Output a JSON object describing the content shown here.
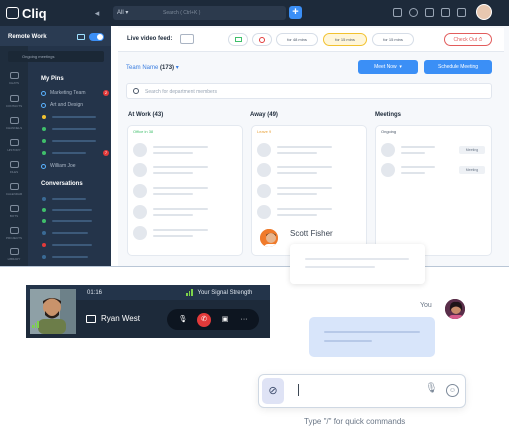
{
  "app": {
    "logo_text": "Cliq"
  },
  "topbar": {
    "scope_label": "All",
    "search_placeholder": "Search ( Ctrl+K )",
    "add_label": "+"
  },
  "workspace": {
    "name": "Remote Work",
    "ongoing_label": "Ongoing meetings"
  },
  "rail": [
    {
      "label": "CHATS",
      "icon": "chat-icon"
    },
    {
      "label": "CONTACTS",
      "icon": "contacts-icon"
    },
    {
      "label": "CHANNELS",
      "icon": "channels-icon"
    },
    {
      "label": "HISTORY",
      "icon": "history-icon"
    },
    {
      "label": "FILES",
      "icon": "files-icon"
    },
    {
      "label": "CALENDAR",
      "icon": "calendar-icon"
    },
    {
      "label": "BOTS",
      "icon": "bots-icon"
    },
    {
      "label": "PROJECTS",
      "icon": "projects-icon"
    },
    {
      "label": "LIBRARY",
      "icon": "library-icon"
    }
  ],
  "pins": {
    "title": "My Pins",
    "items": [
      {
        "label": "Marketing Team",
        "badge": "2"
      },
      {
        "label": "Art and Design",
        "badge": ""
      }
    ],
    "extra_item": "William Joe",
    "extra_badge": "7"
  },
  "conversations": {
    "title": "Conversations"
  },
  "feed": {
    "label": "Live video feed:",
    "chips": [
      "for 48 mins",
      "for 15 mins",
      "for 15 mins"
    ],
    "checkout": "Check Out"
  },
  "team": {
    "name": "Team Name",
    "count": "(173)",
    "meet_now": "Meet Now",
    "schedule": "Schedule Meeting",
    "search_placeholder": "Search for department members"
  },
  "columns": {
    "at_work": {
      "title": "At Work (43)",
      "tag": "Office in 38"
    },
    "away": {
      "title": "Away (49)",
      "tag": "Leave 9"
    },
    "meetings": {
      "title": "Meetings",
      "tag": "Ongoing",
      "badge": "Meeting"
    }
  },
  "hover_user": {
    "name": "Scott Fisher"
  },
  "call": {
    "duration": "01:16",
    "signal": "Your Signal Strength",
    "callee": "Ryan West"
  },
  "chat": {
    "sender": "You",
    "hint": "Type \"/\" for quick commands"
  },
  "colors": {
    "accent": "#3b8ff6",
    "sidebar": "#24344a",
    "topbar": "#1d2a3a",
    "danger": "#e23a3a"
  }
}
